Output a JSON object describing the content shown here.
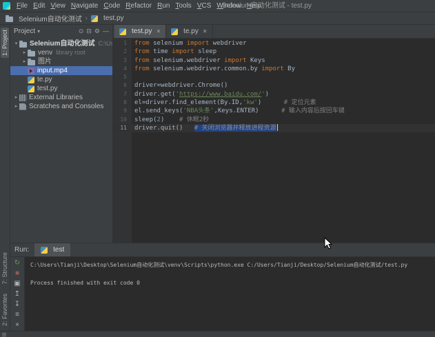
{
  "colors": {
    "selection": "#4b6eaf",
    "keyword": "#cc7832",
    "string": "#6a8759",
    "comment": "#808080",
    "number": "#6897bb",
    "editor_bg": "#2b2b2b",
    "panel_bg": "#3c3f41"
  },
  "window": {
    "title": "Selenium自动化测试 - test.py"
  },
  "menu": [
    "File",
    "Edit",
    "View",
    "Navigate",
    "Code",
    "Refactor",
    "Run",
    "Tools",
    "VCS",
    "Window",
    "Help"
  ],
  "breadcrumb": [
    {
      "label": "Selenium自动化测试",
      "icon": "folder"
    },
    {
      "label": "test.py",
      "icon": "python"
    }
  ],
  "tool_strip": {
    "top": "1: Project",
    "bottom": [
      "7: Structure",
      "2: Favorites"
    ]
  },
  "project_panel": {
    "title": "Project",
    "caret": "▾",
    "toolbar": [
      {
        "name": "locate-icon",
        "glyph": "⊙"
      },
      {
        "name": "collapse-all-icon",
        "glyph": "⊟"
      },
      {
        "name": "settings-gear-icon",
        "glyph": "⚙"
      },
      {
        "name": "hide-panel-icon",
        "glyph": "—"
      }
    ],
    "tree": [
      {
        "label": "Selenium自动化测试",
        "hint": "C:\\Users\\Tianji",
        "icon": "folder",
        "depth": 0,
        "chevron": "open",
        "bold": true
      },
      {
        "label": "venv",
        "hint": "library root",
        "icon": "folder",
        "depth": 1,
        "chevron": "closed"
      },
      {
        "label": "图片",
        "icon": "folder",
        "depth": 1,
        "chevron": "closed"
      },
      {
        "label": "input.mp4",
        "icon": "media",
        "depth": 1,
        "selected": true
      },
      {
        "label": "te.py",
        "icon": "python",
        "depth": 1
      },
      {
        "label": "test.py",
        "icon": "python",
        "depth": 1
      },
      {
        "label": "External Libraries",
        "icon": "libraries",
        "depth": 0,
        "chevron": "closed"
      },
      {
        "label": "Scratches and Consoles",
        "icon": "scratches",
        "depth": 0,
        "chevron": "closed"
      }
    ]
  },
  "editor": {
    "tabs": [
      {
        "label": "test.py",
        "icon": "python",
        "active": true,
        "close": "✕"
      },
      {
        "label": "te.py",
        "icon": "python",
        "active": false,
        "close": "✕"
      }
    ],
    "code": [
      {
        "n": 1,
        "seg": [
          [
            "k",
            "from"
          ],
          [
            "d",
            " selenium "
          ],
          [
            "k",
            "import"
          ],
          [
            "d",
            " webdriver"
          ]
        ]
      },
      {
        "n": 2,
        "seg": [
          [
            "k",
            "from"
          ],
          [
            "d",
            " time "
          ],
          [
            "k",
            "import"
          ],
          [
            "d",
            " sleep"
          ]
        ]
      },
      {
        "n": 3,
        "seg": [
          [
            "k",
            "from"
          ],
          [
            "d",
            " selenium.webdriver "
          ],
          [
            "k",
            "import"
          ],
          [
            "d",
            " Keys"
          ]
        ]
      },
      {
        "n": 4,
        "seg": [
          [
            "k",
            "from"
          ],
          [
            "d",
            " selenium.webdriver.common.by "
          ],
          [
            "k",
            "import"
          ],
          [
            "d",
            " By"
          ]
        ]
      },
      {
        "n": 5,
        "seg": []
      },
      {
        "n": 6,
        "seg": [
          [
            "d",
            "driver=webdriver.Chrome()"
          ]
        ]
      },
      {
        "n": 7,
        "seg": [
          [
            "d",
            "driver.get("
          ],
          [
            "s",
            "'"
          ],
          [
            "su",
            "https://www.baidu.com/"
          ],
          [
            "s",
            "'"
          ],
          [
            "d",
            ")"
          ]
        ]
      },
      {
        "n": 8,
        "seg": [
          [
            "d",
            "el=driver.find_element(By.ID,"
          ],
          [
            "s",
            "'kw'"
          ],
          [
            "d",
            ")      "
          ],
          [
            "c",
            "# 定位元素"
          ]
        ]
      },
      {
        "n": 9,
        "seg": [
          [
            "d",
            "el.send_keys("
          ],
          [
            "s",
            "'NBA头条'"
          ],
          [
            "d",
            ",Keys.ENTER)      "
          ],
          [
            "c",
            "# 输入内容后按回车键"
          ]
        ]
      },
      {
        "n": 10,
        "seg": [
          [
            "d",
            "sleep("
          ],
          [
            "num",
            "2"
          ],
          [
            "d",
            ")    "
          ],
          [
            "c",
            "# 休眠2秒"
          ]
        ]
      },
      {
        "n": 11,
        "seg": [
          [
            "d",
            "driver.quit()   "
          ],
          [
            "csel",
            "# 关闭浏览器并释放进程资源"
          ]
        ],
        "current": true,
        "caret": true
      }
    ]
  },
  "run_panel": {
    "label": "Run:",
    "tab": {
      "label": "test",
      "icon": "python"
    },
    "toolbar": [
      {
        "name": "rerun-icon",
        "glyph": "↻",
        "color": "#5f9956"
      },
      {
        "name": "stop-icon",
        "glyph": "■",
        "color": "#8e5b5b"
      },
      {
        "name": "restore-layout-icon",
        "glyph": "▣",
        "color": "#afb1b3"
      },
      {
        "name": "up-stack-trace-icon",
        "glyph": "↥",
        "color": "#afb1b3"
      },
      {
        "name": "down-stack-trace-icon",
        "glyph": "↧",
        "color": "#afb1b3"
      },
      {
        "name": "soft-wrap-icon",
        "glyph": "≡",
        "color": "#afb1b3"
      },
      {
        "name": "clear-console-icon",
        "glyph": "×",
        "color": "#afb1b3"
      }
    ],
    "console": [
      "C:\\Users\\Tianji\\Desktop\\Selenium自动化测试\\venv\\Scripts\\python.exe C:/Users/Tianji/Desktop/Selenium自动化测试/test.py",
      "",
      "Process finished with exit code 0"
    ]
  }
}
